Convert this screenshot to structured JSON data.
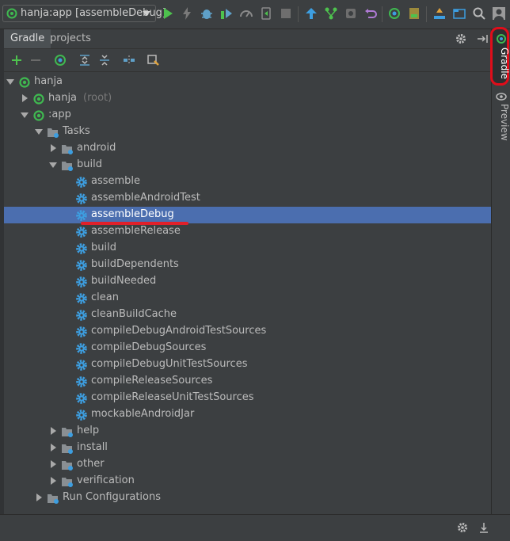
{
  "toolbar": {
    "run_config_label": "hanja:app [assembleDebug]",
    "icons": [
      "run-icon",
      "lightning-icon",
      "debug-icon",
      "run-with-coverage-icon",
      "profile-icon",
      "apply-changes-icon",
      "stop-icon",
      "sync-icon",
      "vcs-icon",
      "device-manager-icon",
      "undo-icon",
      "gradle-sync-icon",
      "sdk-manager-icon",
      "build-variants-icon",
      "project-structure-icon",
      "search-icon",
      "account-icon"
    ]
  },
  "tabs": [
    {
      "label": "Gradle",
      "active": true
    },
    {
      "label": "projects",
      "active": false
    }
  ],
  "tree": [
    {
      "label": "hanja",
      "depth": 0,
      "expanded": true,
      "icon": "gradle-icon"
    },
    {
      "label": "hanja",
      "suffix": "(root)",
      "depth": 1,
      "expanded": false,
      "icon": "gradle-icon"
    },
    {
      "label": ":app",
      "depth": 1,
      "expanded": true,
      "icon": "gradle-icon"
    },
    {
      "label": "Tasks",
      "depth": 2,
      "expanded": true,
      "icon": "folder-icon"
    },
    {
      "label": "android",
      "depth": 3,
      "expanded": false,
      "icon": "folder-icon"
    },
    {
      "label": "build",
      "depth": 3,
      "expanded": true,
      "icon": "folder-icon"
    },
    {
      "label": "assemble",
      "depth": 4,
      "icon": "gear-icon"
    },
    {
      "label": "assembleAndroidTest",
      "depth": 4,
      "icon": "gear-icon"
    },
    {
      "label": "assembleDebug",
      "depth": 4,
      "icon": "gear-icon",
      "selected": true
    },
    {
      "label": "assembleRelease",
      "depth": 4,
      "icon": "gear-icon"
    },
    {
      "label": "build",
      "depth": 4,
      "icon": "gear-icon"
    },
    {
      "label": "buildDependents",
      "depth": 4,
      "icon": "gear-icon"
    },
    {
      "label": "buildNeeded",
      "depth": 4,
      "icon": "gear-icon"
    },
    {
      "label": "clean",
      "depth": 4,
      "icon": "gear-icon"
    },
    {
      "label": "cleanBuildCache",
      "depth": 4,
      "icon": "gear-icon"
    },
    {
      "label": "compileDebugAndroidTestSources",
      "depth": 4,
      "icon": "gear-icon"
    },
    {
      "label": "compileDebugSources",
      "depth": 4,
      "icon": "gear-icon"
    },
    {
      "label": "compileDebugUnitTestSources",
      "depth": 4,
      "icon": "gear-icon"
    },
    {
      "label": "compileReleaseSources",
      "depth": 4,
      "icon": "gear-icon"
    },
    {
      "label": "compileReleaseUnitTestSources",
      "depth": 4,
      "icon": "gear-icon"
    },
    {
      "label": "mockableAndroidJar",
      "depth": 4,
      "icon": "gear-icon"
    },
    {
      "label": "help",
      "depth": 3,
      "expanded": false,
      "icon": "folder-icon"
    },
    {
      "label": "install",
      "depth": 3,
      "expanded": false,
      "icon": "folder-icon"
    },
    {
      "label": "other",
      "depth": 3,
      "expanded": false,
      "icon": "folder-icon"
    },
    {
      "label": "verification",
      "depth": 3,
      "expanded": false,
      "icon": "folder-icon"
    },
    {
      "label": "Run Configurations",
      "depth": 2,
      "expanded": false,
      "icon": "folder-icon"
    }
  ],
  "side_tabs": {
    "gradle": "Gradle",
    "preview": "Preview"
  },
  "colors": {
    "background": "#3c3f41",
    "selection": "#4b6eaf",
    "annotation_red": "#e00d1a",
    "gradle_green": "#3fb950",
    "gear_blue": "#3d9ee0"
  }
}
